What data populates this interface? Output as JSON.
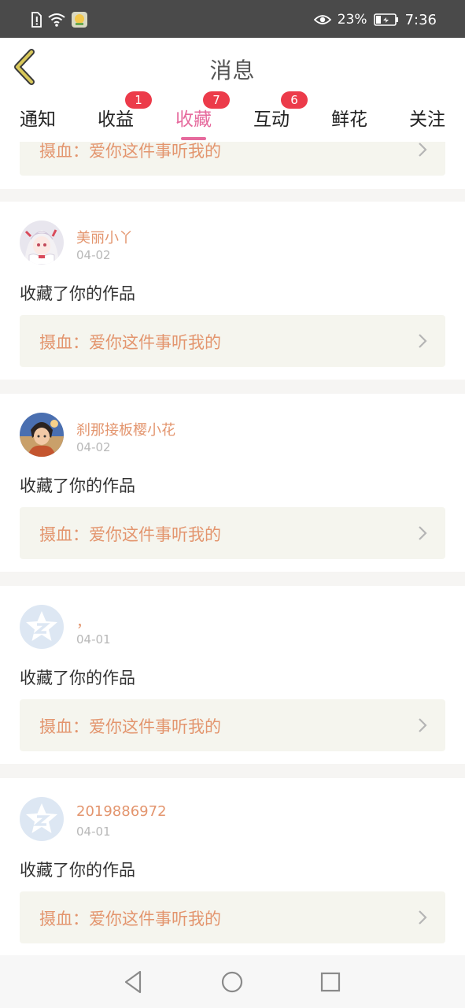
{
  "statusbar": {
    "battery_percent": "23%",
    "time": "7:36",
    "icons": [
      "sim-alert-icon",
      "wifi-icon",
      "app-notification-icon",
      "eye-comfort-icon",
      "battery-icon"
    ]
  },
  "header": {
    "title": "消息",
    "back_icon": "chevron-left-icon"
  },
  "colors": {
    "accent": "#e66a9d",
    "badge": "#ec3b4a",
    "username": "#e3956e",
    "work_bg": "#f5f5ee"
  },
  "tabs": [
    {
      "label": "通知",
      "badge": ""
    },
    {
      "label": "收益",
      "badge": "1"
    },
    {
      "label": "收藏",
      "badge": "7",
      "active": true
    },
    {
      "label": "互动",
      "badge": "6"
    },
    {
      "label": "鲜花",
      "badge": ""
    },
    {
      "label": "关注",
      "badge": ""
    }
  ],
  "partial_item": {
    "work_title": "摄血：爱你这件事听我的"
  },
  "notifications": [
    {
      "username": "美丽小丫",
      "date": "04-02",
      "action": "收藏了你的作品",
      "work_title": "摄血：爱你这件事听我的",
      "avatar": "anime-girl-avatar"
    },
    {
      "username": "刹那接板樱小花",
      "date": "04-02",
      "action": "收藏了你的作品",
      "work_title": "摄血：爱你这件事听我的",
      "avatar": "anime-boy-avatar"
    },
    {
      "username": "，",
      "date": "04-01",
      "action": "收藏了你的作品",
      "work_title": "摄血：爱你这件事听我的",
      "avatar": "default-star-avatar"
    },
    {
      "username": "2019886972",
      "date": "04-01",
      "action": "收藏了你的作品",
      "work_title": "摄血：爱你这件事听我的",
      "avatar": "default-star-avatar"
    }
  ],
  "navbar": {
    "icons": [
      "back-triangle-icon",
      "home-circle-icon",
      "recents-square-icon"
    ]
  }
}
